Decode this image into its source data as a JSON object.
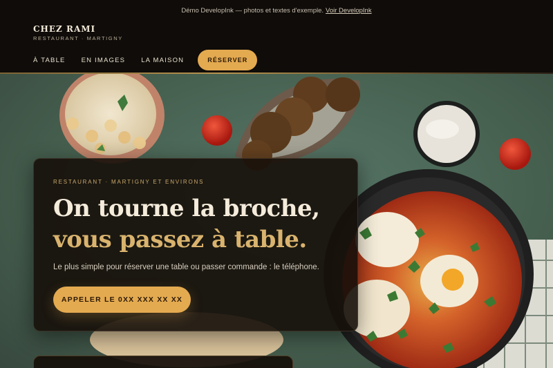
{
  "demo_bar": {
    "text": "Démo DevelopInk — photos et textes d'exemple.",
    "link": "Voir DevelopInk"
  },
  "brand": {
    "name": "CHEZ RAMI",
    "subtitle": "RESTAURANT · MARTIGNY"
  },
  "nav": {
    "items": [
      {
        "label": "À TABLE"
      },
      {
        "label": "EN IMAGES"
      },
      {
        "label": "LA MAISON"
      }
    ],
    "cta": "RÉSERVER"
  },
  "hero": {
    "eyebrow": "RESTAURANT · MARTIGNY ET ENVIRONS",
    "headline_line1": "On tourne la broche,",
    "headline_line2": "vous passez à table.",
    "lede": "Le plus simple pour réserver une table ou passer commande : le téléphone.",
    "call_button": "APPELER LE 0XX XXX XX XX"
  },
  "colors": {
    "accent": "#e4aa50",
    "headline_accent": "#d9b36e",
    "background": "#0f0c09",
    "table_green": "#4f6d5f"
  }
}
